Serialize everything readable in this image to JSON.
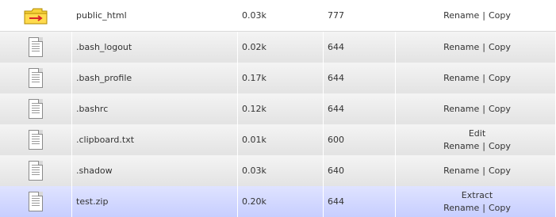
{
  "files": [
    {
      "name": "public_html",
      "size": "0.03k",
      "perms": "777",
      "icon": "folder-redirect-icon",
      "actions_line1": [],
      "actions_line2": [
        "Rename",
        "Copy"
      ]
    },
    {
      "name": ".bash_logout",
      "size": "0.02k",
      "perms": "644",
      "icon": "file-icon",
      "actions_line1": [],
      "actions_line2": [
        "Rename",
        "Copy"
      ]
    },
    {
      "name": ".bash_profile",
      "size": "0.17k",
      "perms": "644",
      "icon": "file-icon",
      "actions_line1": [],
      "actions_line2": [
        "Rename",
        "Copy"
      ]
    },
    {
      "name": ".bashrc",
      "size": "0.12k",
      "perms": "644",
      "icon": "file-icon",
      "actions_line1": [],
      "actions_line2": [
        "Rename",
        "Copy"
      ]
    },
    {
      "name": ".clipboard.txt",
      "size": "0.01k",
      "perms": "600",
      "icon": "file-icon",
      "actions_line1": [
        "Edit"
      ],
      "actions_line2": [
        "Rename",
        "Copy"
      ]
    },
    {
      "name": ".shadow",
      "size": "0.03k",
      "perms": "640",
      "icon": "file-icon",
      "actions_line1": [],
      "actions_line2": [
        "Rename",
        "Copy"
      ]
    },
    {
      "name": "test.zip",
      "size": "0.20k",
      "perms": "644",
      "icon": "file-icon",
      "actions_line1": [
        "Extract"
      ],
      "actions_line2": [
        "Rename",
        "Copy"
      ]
    }
  ],
  "action_separator": "|",
  "colors": {
    "selected_row": "#c7ceff",
    "row_gray": "#e3e3e3",
    "folder_yellow": "#f2c200",
    "arrow_red": "#d8262a"
  }
}
